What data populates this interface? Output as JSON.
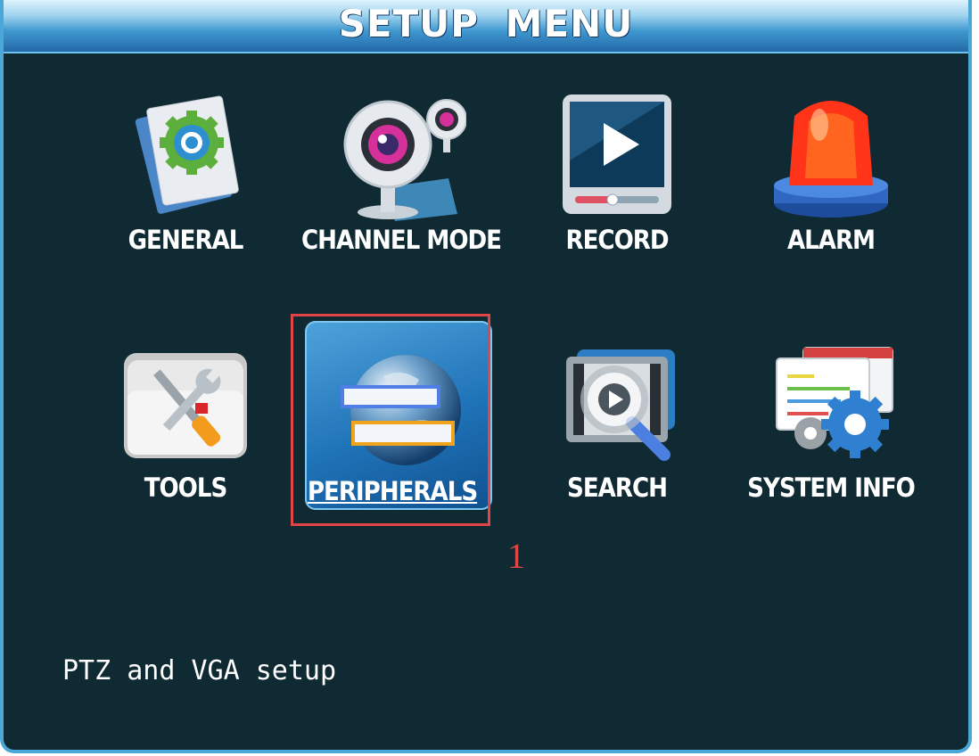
{
  "window": {
    "title": "SETUP MENU"
  },
  "menu": {
    "items": [
      {
        "label": "GENERAL",
        "icon": "gear-document-icon"
      },
      {
        "label": "CHANNEL MODE",
        "icon": "webcam-icon"
      },
      {
        "label": "RECORD",
        "icon": "play-video-icon"
      },
      {
        "label": "ALARM",
        "icon": "siren-light-icon"
      },
      {
        "label": "TOOLS",
        "icon": "wrench-screwdriver-icon"
      },
      {
        "label": "PERIPHERALS",
        "icon": "globe-icon",
        "selected": true
      },
      {
        "label": "SEARCH",
        "icon": "magnifier-film-icon"
      },
      {
        "label": "SYSTEM INFO",
        "icon": "gears-window-icon"
      }
    ]
  },
  "status": {
    "description": "PTZ and VGA setup"
  },
  "annotation": {
    "number": "1",
    "color": "#e24545"
  },
  "colors": {
    "background": "#0f2a33",
    "accent": "#4aa7d8",
    "selected": "#1f73b8"
  }
}
